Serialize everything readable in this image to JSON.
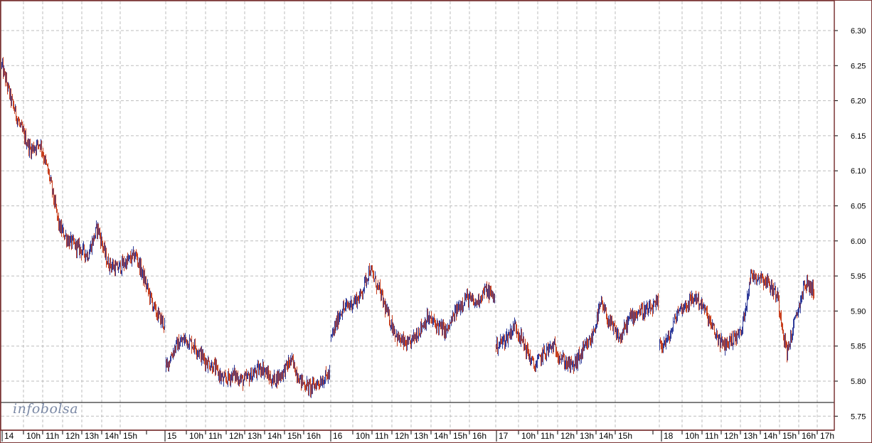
{
  "logo": {
    "text": "infobolsa"
  },
  "colors": {
    "background": "#ffffff",
    "frame": "#7b3535",
    "grid": "#bdbdbd",
    "bar_up": "#2f3b9a",
    "bar_down": "#c8401f",
    "axis_text": "#000000"
  },
  "chart_data": {
    "type": "ohlc",
    "grid": true,
    "ylim": [
      5.73,
      6.33
    ],
    "y_ticks": [
      "6.30",
      "6.25",
      "6.20",
      "6.15",
      "6.10",
      "6.05",
      "6.00",
      "5.95",
      "5.90",
      "5.85",
      "5.80",
      "5.75"
    ],
    "x_tick_labels": [
      "14",
      "10h",
      "11h",
      "12h",
      "13h",
      "14h",
      "15h",
      "15",
      "10h",
      "11h",
      "12h",
      "13h",
      "14h",
      "15h",
      "16h",
      "16",
      "10h",
      "11h",
      "12h",
      "13h",
      "14h",
      "15h",
      "16h",
      "17",
      "10h",
      "11h",
      "12h",
      "13h",
      "14h",
      "15h",
      "18",
      "10h",
      "11h",
      "12h",
      "13h",
      "14h",
      "15h",
      "16h",
      "17h"
    ],
    "x": [
      "14 09:00",
      "14 09:30",
      "14 10:00",
      "14 10:30",
      "14 11:00",
      "14 11:30",
      "14 12:00",
      "14 12:30",
      "14 13:00",
      "14 13:30",
      "14 14:00",
      "14 14:30",
      "14 15:00",
      "14 15:30",
      "14 16:00",
      "14 16:30",
      "14 17:00",
      "14 17:30",
      "15 09:00",
      "15 09:30",
      "15 10:00",
      "15 10:30",
      "15 11:00",
      "15 11:30",
      "15 12:00",
      "15 12:30",
      "15 13:00",
      "15 13:30",
      "15 14:00",
      "15 14:30",
      "15 15:00",
      "15 15:30",
      "15 16:00",
      "15 16:30",
      "15 17:00",
      "15 17:30",
      "16 09:00",
      "16 09:30",
      "16 10:00",
      "16 10:30",
      "16 11:00",
      "16 11:30",
      "16 12:00",
      "16 12:30",
      "16 13:00",
      "16 13:30",
      "16 14:00",
      "16 14:30",
      "16 15:00",
      "16 15:30",
      "16 16:00",
      "16 16:30",
      "16 17:00",
      "16 17:30",
      "17 09:00",
      "17 09:30",
      "17 10:00",
      "17 10:30",
      "17 11:00",
      "17 11:30",
      "17 12:00",
      "17 12:30",
      "17 13:00",
      "17 13:30",
      "17 14:00",
      "17 14:30",
      "17 15:00",
      "17 15:30",
      "17 16:00",
      "17 16:30",
      "17 17:00",
      "17 17:30",
      "18 09:00",
      "18 09:30",
      "18 10:00",
      "18 10:30",
      "18 11:00",
      "18 11:30",
      "18 12:00",
      "18 12:30",
      "18 13:00",
      "18 13:30",
      "18 14:00",
      "18 14:30",
      "18 15:00",
      "18 15:30",
      "18 16:00",
      "18 16:30",
      "18 17:00",
      "18 17:30"
    ],
    "series": [
      {
        "values": [
          6.25,
          6.2,
          6.16,
          6.13,
          6.14,
          6.09,
          6.02,
          6.0,
          5.99,
          5.98,
          6.02,
          5.97,
          5.96,
          5.97,
          5.98,
          5.94,
          5.9,
          5.88,
          5.82,
          5.85,
          5.86,
          5.85,
          5.83,
          5.82,
          5.8,
          5.81,
          5.8,
          5.81,
          5.82,
          5.8,
          5.81,
          5.83,
          5.8,
          5.79,
          5.8,
          5.81,
          5.86,
          5.9,
          5.91,
          5.92,
          5.96,
          5.93,
          5.89,
          5.86,
          5.85,
          5.87,
          5.89,
          5.88,
          5.87,
          5.9,
          5.92,
          5.91,
          5.93,
          5.92,
          5.85,
          5.86,
          5.88,
          5.85,
          5.82,
          5.84,
          5.85,
          5.83,
          5.82,
          5.84,
          5.86,
          5.91,
          5.88,
          5.86,
          5.89,
          5.9,
          5.9,
          5.91,
          5.85,
          5.86,
          5.9,
          5.91,
          5.92,
          5.9,
          5.87,
          5.85,
          5.86,
          5.87,
          5.95,
          5.95,
          5.94,
          5.92,
          5.84,
          5.89,
          5.94,
          5.93
        ]
      }
    ]
  }
}
